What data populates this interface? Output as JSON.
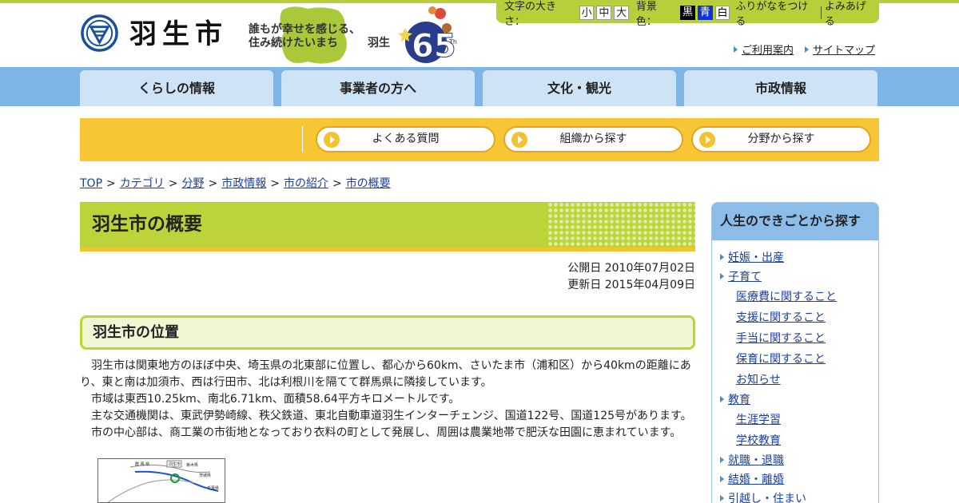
{
  "header": {
    "city_name": "羽生市",
    "tagline_line1": "誰もが幸せを感じる、",
    "tagline_line2": "住み続けたいまち",
    "tagline_city": "羽生",
    "anniversary_th": "Th"
  },
  "accessibility": {
    "font_size_label": "文字の大きさ：",
    "size_small": "小",
    "size_medium": "中",
    "size_large": "大",
    "bg_label": "背景色：",
    "bg_black": "黒",
    "bg_blue": "青",
    "bg_white": "白",
    "furigana": "ふりがなをつける",
    "read_aloud": "よみあげる"
  },
  "utility_links": {
    "guide": "ご利用案内",
    "sitemap": "サイトマップ"
  },
  "global_nav": [
    {
      "label": "くらしの情報"
    },
    {
      "label": "事業者の方へ"
    },
    {
      "label": "文化・観光"
    },
    {
      "label": "市政情報"
    }
  ],
  "quick_search": [
    {
      "label": "よくある質問"
    },
    {
      "label": "組織から探す"
    },
    {
      "label": "分野から探す"
    }
  ],
  "breadcrumb": {
    "items": [
      "TOP",
      "カテゴリ",
      "分野",
      "市政情報",
      "市の紹介",
      "市の概要"
    ],
    "separator": ">"
  },
  "page": {
    "title": "羽生市の概要",
    "published": "公開日 2010年07月02日",
    "updated": "更新日 2015年04月09日",
    "section_title": "羽生市の位置",
    "paragraphs": [
      "羽生市は関東地方のほぼ中央、埼玉県の北東部に位置し、都心から60km、さいたま市（浦和区）から40kmの距離にあり、東と南は加須市、西は行田市、北は利根川を隔てて群馬県に隣接しています。",
      "市域は東西10.25km、南北6.71km、面積58.64平方キロメートルです。",
      "主な交通機関は、東武伊勢崎線、秩父鉄道、東北自動車道羽生インターチェンジ、国道122号、国道125号があります。",
      "市の中心部は、商工業の市街地となっており衣料の町として発展し、周囲は農業地帯で肥沃な田園に恵まれています。"
    ],
    "map_labels": {
      "gunma": "群 馬 県",
      "hanyu": "羽生市",
      "tochigi": "栃木県",
      "ibaraki": "茨城県",
      "chiba": "千葉県"
    }
  },
  "sidebar": {
    "title": "人生のできごとから探す",
    "items": [
      {
        "label": "妊娠・出産",
        "level": "cat"
      },
      {
        "label": "子育て",
        "level": "cat"
      },
      {
        "label": "医療費に関すること",
        "level": "sub"
      },
      {
        "label": "支援に関すること",
        "level": "sub"
      },
      {
        "label": "手当に関すること",
        "level": "sub"
      },
      {
        "label": "保育に関すること",
        "level": "sub"
      },
      {
        "label": "お知らせ",
        "level": "sub"
      },
      {
        "label": "教育",
        "level": "cat"
      },
      {
        "label": "生涯学習",
        "level": "sub"
      },
      {
        "label": "学校教育",
        "level": "sub"
      },
      {
        "label": "就職・退職",
        "level": "cat"
      },
      {
        "label": "結婚・離婚",
        "level": "cat"
      },
      {
        "label": "引越し・住まい",
        "level": "cat"
      }
    ]
  },
  "colors": {
    "accent_green": "#bcd43a",
    "nav_blue": "#7db5e6",
    "quick_yellow": "#f7c634",
    "link_blue": "#1a3fa0"
  }
}
